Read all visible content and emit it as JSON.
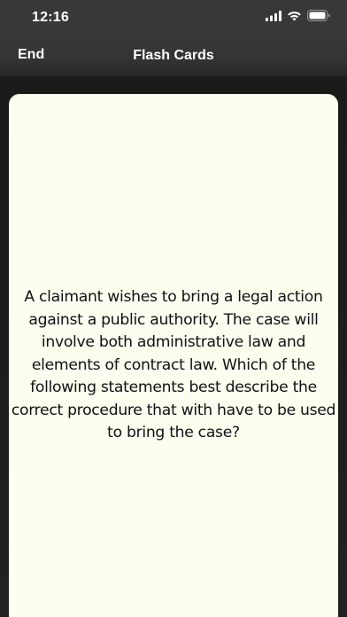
{
  "status_bar": {
    "time": "12:16",
    "icons": [
      "signal-icon",
      "wifi-icon",
      "battery-icon"
    ]
  },
  "nav": {
    "end_label": "End",
    "title": "Flash Cards"
  },
  "card": {
    "question": "A claimant wishes to bring a legal action against a public authority. The case will involve both administrative law and elements of contract law. Which of the following statements best describe the correct procedure that with have to be used to bring the case?"
  },
  "colors": {
    "card_background": "#fdfdf0",
    "nav_background": "#383838",
    "screen_background": "#1d1d1d"
  }
}
